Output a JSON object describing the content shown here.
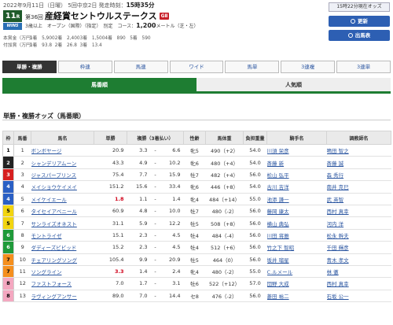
{
  "race": {
    "date": "2022年9月11日（日曜）",
    "meeting": "5回中京2日",
    "post_label": "発走時刻：",
    "post_time": "15時35分",
    "race_number": "11",
    "race_unit": "R",
    "win5_label": "WIN5",
    "race_no_label": "第36回",
    "race_name": "産経賞セントウルステークス",
    "grade": "GⅡ",
    "conditions": "3歳以上　オープン（国際）（指定）　別定　コース：",
    "distance": "1,200",
    "distance_unit": "メートル（芝・左）"
  },
  "prizes": {
    "row1": [
      "本賞金（万円）",
      "1着　5,900",
      "2着　2,400",
      "3着　1,500",
      "4着　890",
      "5着　590"
    ],
    "row2": [
      "付加賞（万円）",
      "1着　93.8",
      "2着　26.8",
      "3着　13.4"
    ]
  },
  "side": {
    "time_status": "15時22分現在オッズ",
    "refresh_label": "更新",
    "print_label": "出馬表"
  },
  "tabs": [
    "単勝・複勝",
    "枠連",
    "馬連",
    "ワイド",
    "馬単",
    "3連複",
    "3連単"
  ],
  "subtabs": [
    "馬番順",
    "人気順"
  ],
  "section_title": "単勝・複勝オッズ（馬番順）",
  "columns": [
    "枠",
    "馬番",
    "馬名",
    "単勝",
    "複勝（3着払い）",
    "性齢",
    "馬体重",
    "負担重量",
    "騎手名",
    "調教師名"
  ],
  "colors": {
    "waku": {
      "1": {
        "bg": "#ffffff",
        "fg": "#000000"
      },
      "2": {
        "bg": "#222222",
        "fg": "#ffffff"
      },
      "3": {
        "bg": "#d62020",
        "fg": "#ffffff"
      },
      "4": {
        "bg": "#2a5fc4",
        "fg": "#ffffff"
      },
      "5": {
        "bg": "#f2d50f",
        "fg": "#000000"
      },
      "6": {
        "bg": "#1f9a3a",
        "fg": "#ffffff"
      },
      "7": {
        "bg": "#f58f1e",
        "fg": "#000000"
      },
      "8": {
        "bg": "#f4a7c0",
        "fg": "#000000"
      }
    }
  },
  "horses": [
    {
      "waku": "1",
      "num": "1",
      "name": "ボンボヤージ",
      "win": "20.9",
      "plc_lo": "3.3",
      "plc_hi": "6.6",
      "sex_age": "牝5",
      "weight": "490（+2）",
      "load": "54.0",
      "jockey": "川須 栄彦",
      "trainer": "鳴田 智之"
    },
    {
      "waku": "2",
      "num": "2",
      "name": "シャンデリアムーン",
      "win": "43.3",
      "plc_lo": "4.9",
      "plc_hi": "10.2",
      "sex_age": "牝6",
      "weight": "480（+4）",
      "load": "54.0",
      "jockey": "斎藤 新",
      "trainer": "斎藤 誠"
    },
    {
      "waku": "3",
      "num": "3",
      "name": "ジャスパープリンス",
      "win": "75.4",
      "plc_lo": "7.7",
      "plc_hi": "15.9",
      "sex_age": "牡7",
      "weight": "482（+4）",
      "load": "56.0",
      "jockey": "松山 弘平",
      "trainer": "森 秀行"
    },
    {
      "waku": "4",
      "num": "4",
      "name": "メイショウケイメイ",
      "win": "151.2",
      "plc_lo": "15.6",
      "plc_hi": "33.4",
      "sex_age": "牝6",
      "weight": "446（+8）",
      "load": "54.0",
      "jockey": "古川 吉洋",
      "trainer": "南井 克巳"
    },
    {
      "waku": "4",
      "num": "5",
      "name": "メイケイエール",
      "win": "1.8",
      "win_red": true,
      "plc_lo": "1.1",
      "plc_hi": "1.4",
      "sex_age": "牝4",
      "weight": "484（+14）",
      "load": "55.0",
      "jockey": "池添 謙一",
      "trainer": "武 英智"
    },
    {
      "waku": "5",
      "num": "6",
      "name": "タイセイアベニール",
      "win": "60.9",
      "plc_lo": "4.8",
      "plc_hi": "10.0",
      "sex_age": "牡7",
      "weight": "480（-2）",
      "load": "56.0",
      "jockey": "藤岡 康太",
      "trainer": "西村 真幸"
    },
    {
      "waku": "5",
      "num": "7",
      "name": "サンライズオネスト",
      "win": "31.1",
      "plc_lo": "5.9",
      "plc_hi": "12.2",
      "sex_age": "牡5",
      "weight": "508（+8）",
      "load": "56.0",
      "jockey": "横山 典弘",
      "trainer": "河内 洋"
    },
    {
      "waku": "6",
      "num": "8",
      "name": "モントライゼ",
      "win": "15.1",
      "plc_lo": "2.3",
      "plc_hi": "4.5",
      "sex_age": "牡4",
      "weight": "484（-4）",
      "load": "56.0",
      "jockey": "川田 将雅",
      "trainer": "松永 幹夫"
    },
    {
      "waku": "6",
      "num": "9",
      "name": "ダディーズビビッド",
      "win": "15.2",
      "plc_lo": "2.3",
      "plc_hi": "4.5",
      "sex_age": "牡4",
      "weight": "512（+6）",
      "load": "56.0",
      "jockey": "竹之下 智昭",
      "trainer": "千田 輝彦"
    },
    {
      "waku": "7",
      "num": "10",
      "name": "チェアリングソング",
      "win": "105.4",
      "plc_lo": "9.9",
      "plc_hi": "20.9",
      "sex_age": "牡5",
      "weight": "464（0）",
      "load": "56.0",
      "jockey": "坂井 瑠星",
      "trainer": "青木 孝文"
    },
    {
      "waku": "7",
      "num": "11",
      "name": "ソングライン",
      "win": "3.3",
      "win_red": true,
      "plc_lo": "1.4",
      "plc_hi": "2.4",
      "sex_age": "牝4",
      "weight": "480（-2）",
      "load": "55.0",
      "jockey": "C.ルメール",
      "trainer": "林 徹"
    },
    {
      "waku": "8",
      "num": "12",
      "name": "ファストフォース",
      "win": "7.0",
      "plc_lo": "1.7",
      "plc_hi": "3.1",
      "sex_age": "牡6",
      "weight": "522（+12）",
      "load": "57.0",
      "jockey": "団野 大成",
      "trainer": "西村 真幸"
    },
    {
      "waku": "8",
      "num": "13",
      "name": "ラヴィングアンサー",
      "win": "89.0",
      "plc_lo": "7.0",
      "plc_hi": "14.4",
      "sex_age": "セ8",
      "weight": "476（-2）",
      "load": "56.0",
      "jockey": "菱田 裕二",
      "trainer": "石坂 公一"
    }
  ]
}
